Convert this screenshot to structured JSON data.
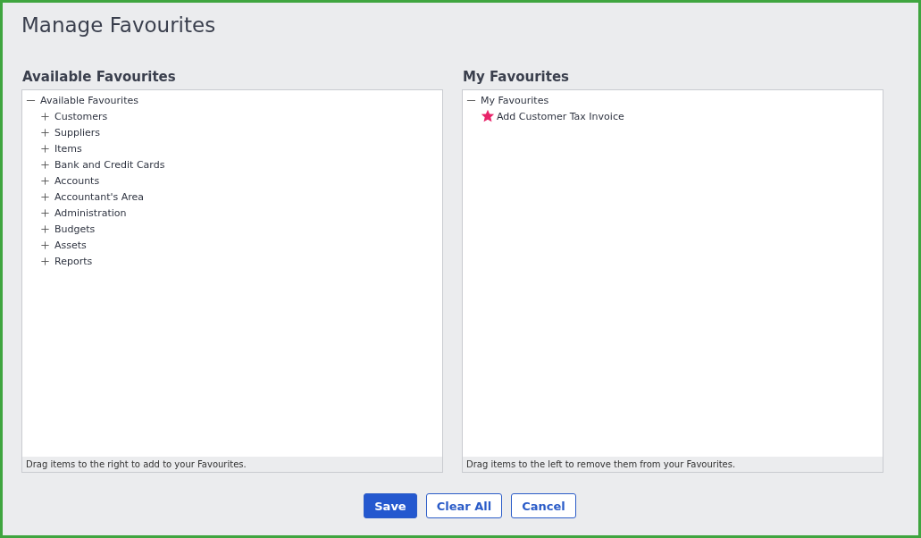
{
  "title": "Manage Favourites",
  "panels": [
    {
      "heading": "Available Favourites",
      "tree": [
        {
          "label": "Available Favourites",
          "expanded": true,
          "children": [
            {
              "label": "Customers",
              "expanded": false
            },
            {
              "label": "Suppliers",
              "expanded": false
            },
            {
              "label": "Items",
              "expanded": false
            },
            {
              "label": "Bank and Credit Cards",
              "expanded": false
            },
            {
              "label": "Accounts",
              "expanded": false
            },
            {
              "label": "Accountant's Area",
              "expanded": false
            },
            {
              "label": "Administration",
              "expanded": false
            },
            {
              "label": "Budgets",
              "expanded": false
            },
            {
              "label": "Assets",
              "expanded": false
            },
            {
              "label": "Reports",
              "expanded": false
            }
          ]
        }
      ],
      "hint": "Drag items to the right to add to your Favourites."
    },
    {
      "heading": "My Favourites",
      "tree": [
        {
          "label": "My Favourites",
          "expanded": true,
          "children": [
            {
              "label": "Add Customer Tax Invoice",
              "kind": "favourite"
            }
          ]
        }
      ],
      "hint": "Drag items to the left to remove them from your Favourites."
    }
  ],
  "buttons": [
    {
      "label": "Save",
      "kind": "primary"
    },
    {
      "label": "Clear All",
      "kind": "secondary"
    },
    {
      "label": "Cancel",
      "kind": "secondary"
    }
  ]
}
